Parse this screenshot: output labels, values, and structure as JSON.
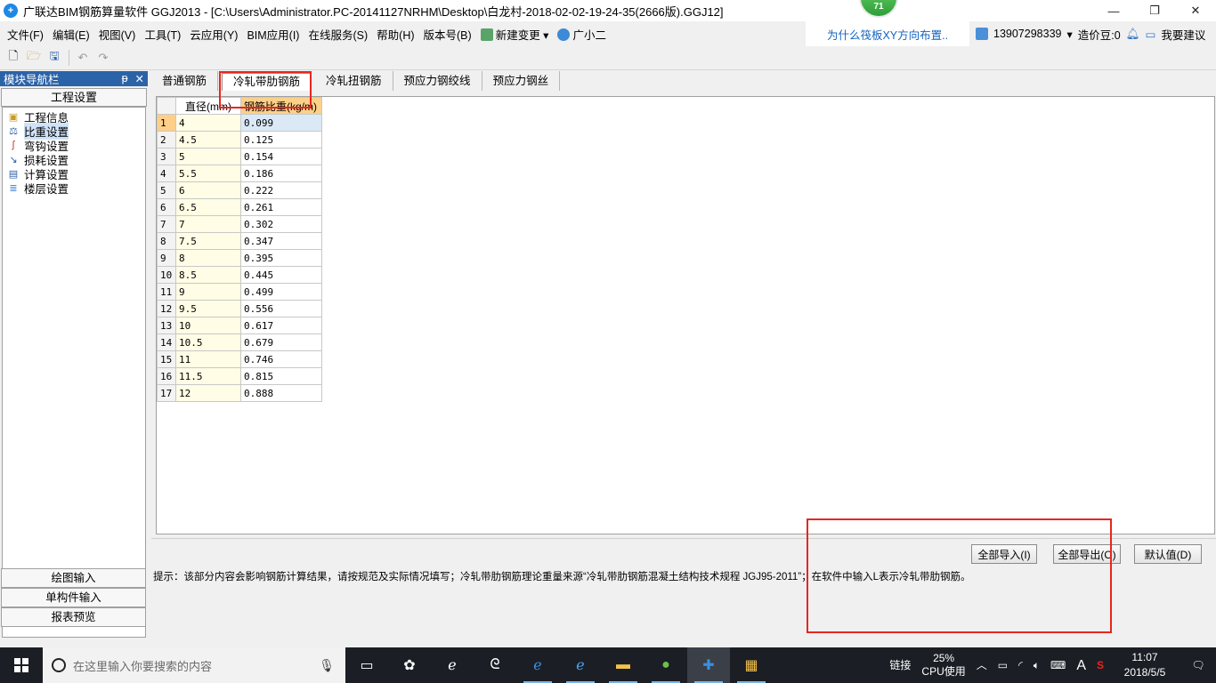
{
  "window": {
    "title": "广联达BIM钢筋算量软件 GGJ2013 - [C:\\Users\\Administrator.PC-20141127NRHM\\Desktop\\白龙村-2018-02-02-19-24-35(2666版).GGJ12]",
    "badge": "71",
    "minimize": "—",
    "restore": "❐",
    "close": "✕"
  },
  "menu": {
    "items": [
      "文件(F)",
      "编辑(E)",
      "视图(V)",
      "工具(T)",
      "云应用(Y)",
      "BIM应用(I)",
      "在线服务(S)",
      "帮助(H)",
      "版本号(B)",
      "新建变更",
      "广小二"
    ],
    "promo": "为什么筏板XY方向布置..",
    "phone": "13907298339",
    "cost_beans": "造价豆:0",
    "suggest": "我要建议"
  },
  "nav": {
    "header": "模块导航栏",
    "pin": "ᵽ",
    "close": "✕",
    "section": "工程设置",
    "items": [
      "工程信息",
      "比重设置",
      "弯钩设置",
      "损耗设置",
      "计算设置",
      "楼层设置"
    ],
    "bottom": [
      "绘图输入",
      "单构件输入",
      "报表预览"
    ]
  },
  "tabs": [
    "普通钢筋",
    "冷轧带肋钢筋",
    "冷轧扭钢筋",
    "预应力钢绞线",
    "预应力钢丝"
  ],
  "grid": {
    "headers": [
      "直径(mm)",
      "钢筋比重(kg/m)"
    ],
    "rows": [
      [
        "1",
        "4",
        "0.099"
      ],
      [
        "2",
        "4.5",
        "0.125"
      ],
      [
        "3",
        "5",
        "0.154"
      ],
      [
        "4",
        "5.5",
        "0.186"
      ],
      [
        "5",
        "6",
        "0.222"
      ],
      [
        "6",
        "6.5",
        "0.261"
      ],
      [
        "7",
        "7",
        "0.302"
      ],
      [
        "8",
        "7.5",
        "0.347"
      ],
      [
        "9",
        "8",
        "0.395"
      ],
      [
        "10",
        "8.5",
        "0.445"
      ],
      [
        "11",
        "9",
        "0.499"
      ],
      [
        "12",
        "9.5",
        "0.556"
      ],
      [
        "13",
        "10",
        "0.617"
      ],
      [
        "14",
        "10.5",
        "0.679"
      ],
      [
        "15",
        "11",
        "0.746"
      ],
      [
        "16",
        "11.5",
        "0.815"
      ],
      [
        "17",
        "12",
        "0.888"
      ]
    ]
  },
  "buttons": {
    "import_all": "全部导入(I)",
    "export_all": "全部导出(O)",
    "default": "默认值(D)"
  },
  "hint": "提示：该部分内容会影响钢筋计算结果，请按规范及实际情况填写；冷轧带肋钢筋理论重量来源“冷轧带肋钢筋混凝土结构技术规程 JGJ95-2011”；在软件中输入L表示冷轧带肋钢筋。",
  "taskbar": {
    "search_placeholder": "在这里输入你要搜索的内容",
    "link_label": "链接",
    "cpu_value": "25%",
    "cpu_label": "CPU使用",
    "ime": "A",
    "time": "11:07",
    "date": "2018/5/5"
  },
  "colors": {
    "highlight_box": "#e8261f",
    "nav_header": "#2b63a8",
    "weight_header": "#fcd088"
  }
}
